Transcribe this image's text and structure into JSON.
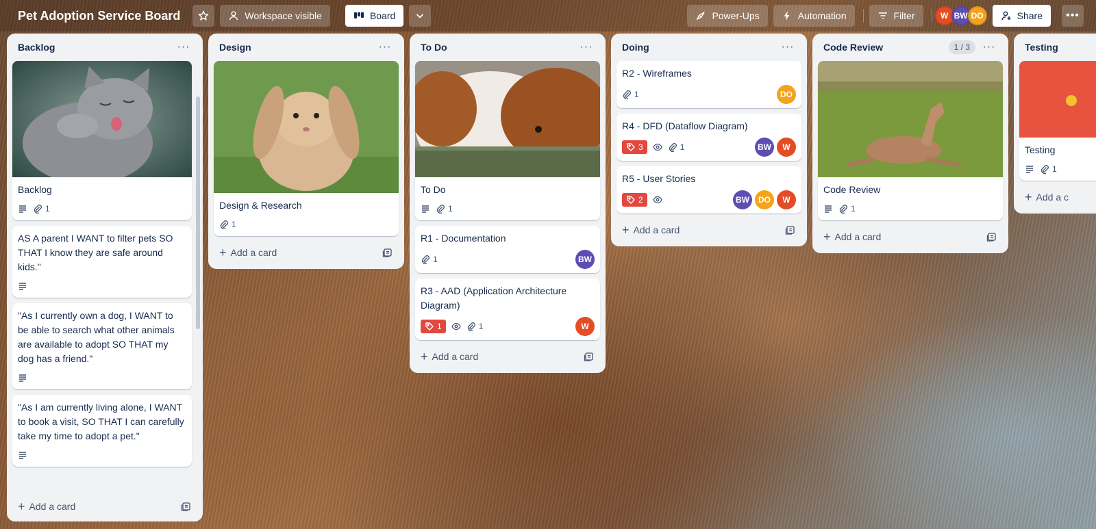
{
  "header": {
    "board_title": "Pet Adoption Service Board",
    "visibility_label": "Workspace visible",
    "view_label": "Board",
    "powerups_label": "Power-Ups",
    "automation_label": "Automation",
    "filter_label": "Filter",
    "share_label": "Share",
    "members": [
      {
        "initials": "W",
        "color": "#e34d25"
      },
      {
        "initials": "BW",
        "color": "#5e4db2"
      },
      {
        "initials": "DO",
        "color": "#f5a31b"
      }
    ]
  },
  "lists": {
    "backlog": {
      "title": "Backlog",
      "add_card": "Add a card",
      "cards": [
        {
          "title": "Backlog",
          "attachments": "1"
        },
        {
          "title": "AS A parent I WANT to filter pets SO THAT I know they are safe around kids.\""
        },
        {
          "title": "\"As I currently own a dog, I WANT to be able to search what other animals are available to adopt SO THAT my dog has a friend.\""
        },
        {
          "title": "\"As I am currently living alone, I WANT to book a visit, SO THAT I can carefully take my time to adopt a pet.\""
        }
      ]
    },
    "design": {
      "title": "Design",
      "add_card": "Add a card",
      "cards": [
        {
          "title": "Design & Research",
          "attachments": "1"
        }
      ]
    },
    "todo": {
      "title": "To Do",
      "add_card": "Add a card",
      "cards": [
        {
          "title": "To Do",
          "attachments": "1"
        },
        {
          "title": "R1 - Documentation",
          "attachments": "1",
          "member": "BW"
        },
        {
          "title": "R3 - AAD (Application Architecture Diagram)",
          "labels": "1",
          "attachments": "1",
          "member": "W"
        }
      ]
    },
    "doing": {
      "title": "Doing",
      "add_card": "Add a card",
      "cards": [
        {
          "title": "R2 - Wireframes",
          "attachments": "1",
          "member": "DO"
        },
        {
          "title": "R4 - DFD (Dataflow Diagram)",
          "labels": "3",
          "attachments": "1",
          "member1": "BW",
          "member2": "W"
        },
        {
          "title": "R5 - User Stories",
          "labels": "2",
          "member1": "BW",
          "member2": "DO",
          "member3": "W"
        }
      ]
    },
    "code_review": {
      "title": "Code Review",
      "count": "1 / 3",
      "add_card": "Add a card",
      "cards": [
        {
          "title": "Code Review",
          "attachments": "1"
        }
      ]
    },
    "testing": {
      "title": "Testing",
      "add_card": "Add a c",
      "cards": [
        {
          "title": "Testing",
          "attachments": "1"
        }
      ]
    }
  }
}
